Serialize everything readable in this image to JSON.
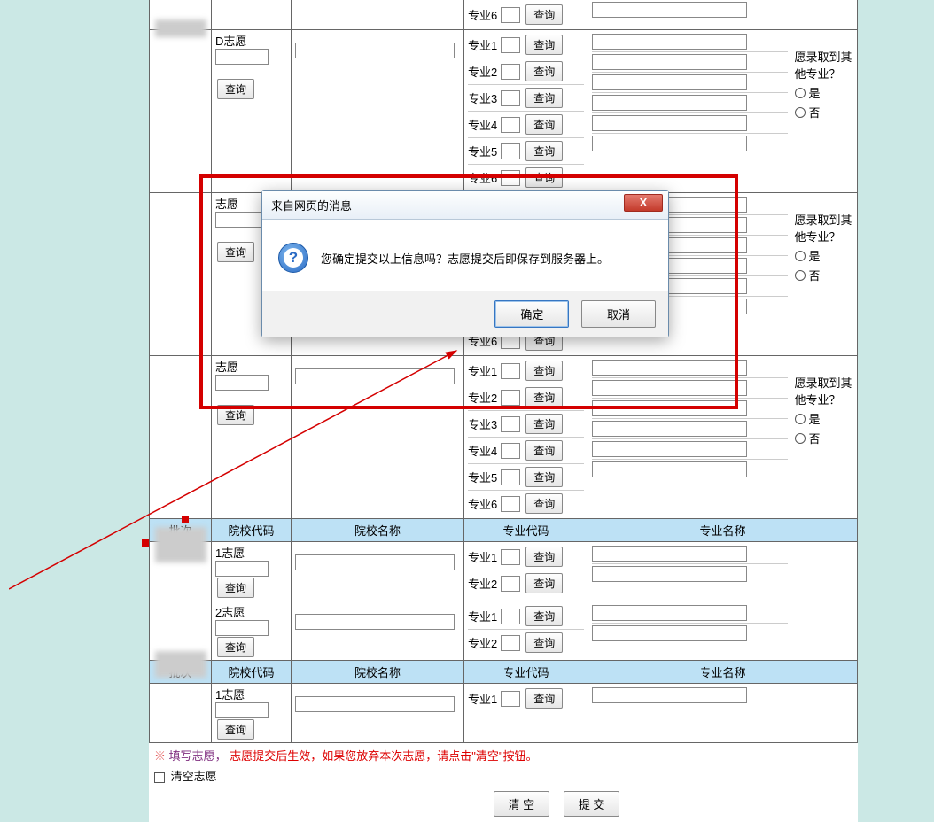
{
  "labels": {
    "query": "查询",
    "major_prefix": "专业",
    "other_admit": "愿录取到其他专业？",
    "yes": "是",
    "no": "否",
    "pc": "批次",
    "school_code": "院校代码",
    "school_name": "院校名称",
    "major_code": "专业代码",
    "major_name": "专业名称",
    "zhiyuan_d": "D志愿",
    "zhiyuan_e": "志愿",
    "zhiyuan_f": "志愿",
    "zhiyuan_1": "1志愿",
    "zhiyuan_2": "2志愿",
    "note_prefix": "填写志愿，",
    "note_red": "志愿提交后生效，如果您放弃本次志愿，请点击\"清空\"按钮。",
    "clear_zhiyuan": "清空志愿",
    "btn_clear": "清 空",
    "btn_submit": "提 交"
  },
  "dialog": {
    "title": "来自网页的消息",
    "message": "您确定提交以上信息吗？志愿提交后即保存到服务器上。",
    "ok": "确定",
    "cancel": "取消",
    "close": "X"
  }
}
